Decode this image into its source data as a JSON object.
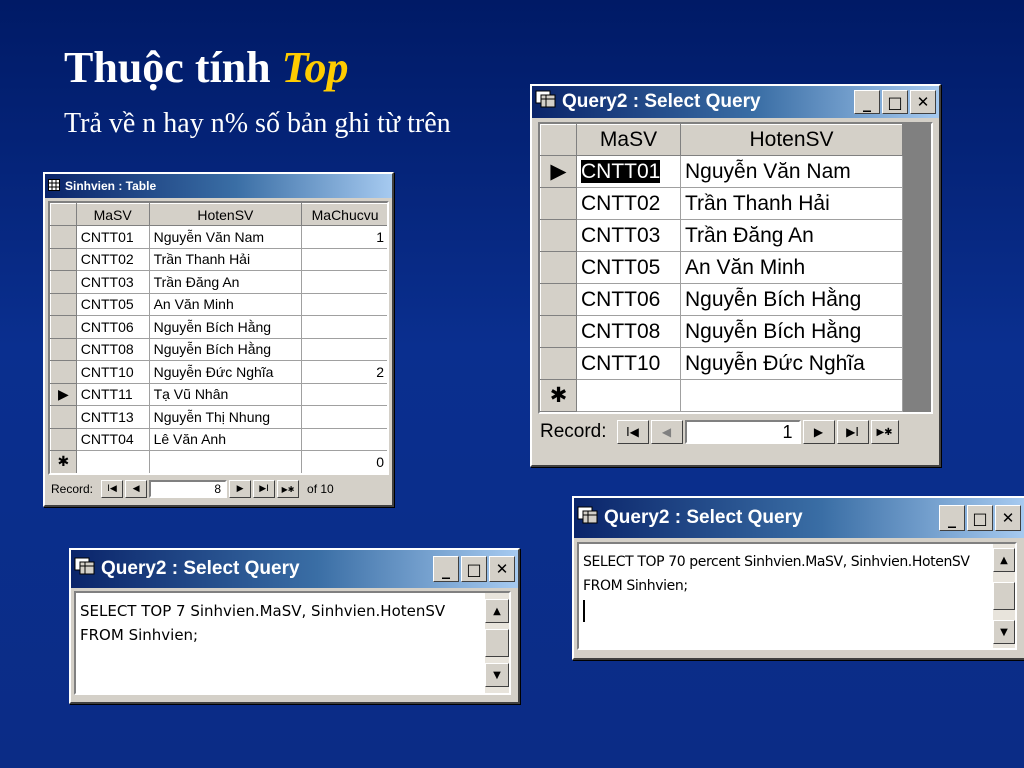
{
  "slide": {
    "title_prefix": "Thuộc tính ",
    "title_em": "Top",
    "subtitle": "Trả về n hay n% số bản ghi từ trên"
  },
  "table_window": {
    "title": "Sinhvien : Table",
    "columns": [
      "MaSV",
      "HotenSV",
      "MaChucvu"
    ],
    "rows": [
      {
        "selector": "",
        "masv": "CNTT01",
        "hoten": "Nguyễn Văn Nam",
        "machucvu": "1"
      },
      {
        "selector": "",
        "masv": "CNTT02",
        "hoten": "Trần Thanh Hải",
        "machucvu": ""
      },
      {
        "selector": "",
        "masv": "CNTT03",
        "hoten": "Trần Đăng An",
        "machucvu": ""
      },
      {
        "selector": "",
        "masv": "CNTT05",
        "hoten": "An Văn Minh",
        "machucvu": ""
      },
      {
        "selector": "",
        "masv": "CNTT06",
        "hoten": "Nguyễn Bích Hằng",
        "machucvu": ""
      },
      {
        "selector": "",
        "masv": "CNTT08",
        "hoten": "Nguyễn Bích Hằng",
        "machucvu": ""
      },
      {
        "selector": "",
        "masv": "CNTT10",
        "hoten": "Nguyễn Đức Nghĩa",
        "machucvu": "2"
      },
      {
        "selector": "▶",
        "masv": "CNTT11",
        "hoten": "Tạ Vũ Nhân",
        "machucvu": ""
      },
      {
        "selector": "",
        "masv": "CNTT13",
        "hoten": "Nguyễn Thị Nhung",
        "machucvu": ""
      },
      {
        "selector": "",
        "masv": "CNTT04",
        "hoten": "Lê Văn Anh",
        "machucvu": ""
      },
      {
        "selector": "✱",
        "masv": "",
        "hoten": "",
        "machucvu": "0"
      }
    ],
    "record_label": "Record:",
    "record_current": "8",
    "record_of": "of 10",
    "nav": {
      "first": "I◀",
      "prev": "◀",
      "next": "▶",
      "last": "▶I",
      "new": "▶✱"
    }
  },
  "result_window": {
    "title": "Query2 : Select Query",
    "columns": [
      "MaSV",
      "HotenSV"
    ],
    "rows": [
      {
        "selector": "▶",
        "masv": "CNTT01",
        "hoten": "Nguyễn Văn Nam"
      },
      {
        "selector": "",
        "masv": "CNTT02",
        "hoten": "Trần Thanh Hải"
      },
      {
        "selector": "",
        "masv": "CNTT03",
        "hoten": "Trần Đăng An"
      },
      {
        "selector": "",
        "masv": "CNTT05",
        "hoten": "An Văn Minh"
      },
      {
        "selector": "",
        "masv": "CNTT06",
        "hoten": "Nguyễn Bích Hằng"
      },
      {
        "selector": "",
        "masv": "CNTT08",
        "hoten": "Nguyễn Bích Hằng"
      },
      {
        "selector": "",
        "masv": "CNTT10",
        "hoten": "Nguyễn Đức Nghĩa"
      },
      {
        "selector": "✱",
        "masv": "",
        "hoten": ""
      }
    ],
    "record_label": "Record:",
    "record_current": "1",
    "nav": {
      "first": "I◀",
      "prev": "◀",
      "next": "▶",
      "last": "▶I",
      "new": "▶✱"
    }
  },
  "sql_window_1": {
    "title": "Query2 : Select Query",
    "line1": "SELECT TOP 7 Sinhvien.MaSV, Sinhvien.HotenSV",
    "line2": "FROM Sinhvien;"
  },
  "sql_window_2": {
    "title": "Query2 : Select Query",
    "line1": "SELECT TOP 70 percent Sinhvien.MaSV, Sinhvien.HotenSV",
    "line2": "FROM Sinhvien;"
  },
  "window_buttons": {
    "minimize": "_",
    "maximize": "□",
    "close": "✕"
  },
  "scroll": {
    "up": "▲",
    "down": "▼"
  }
}
